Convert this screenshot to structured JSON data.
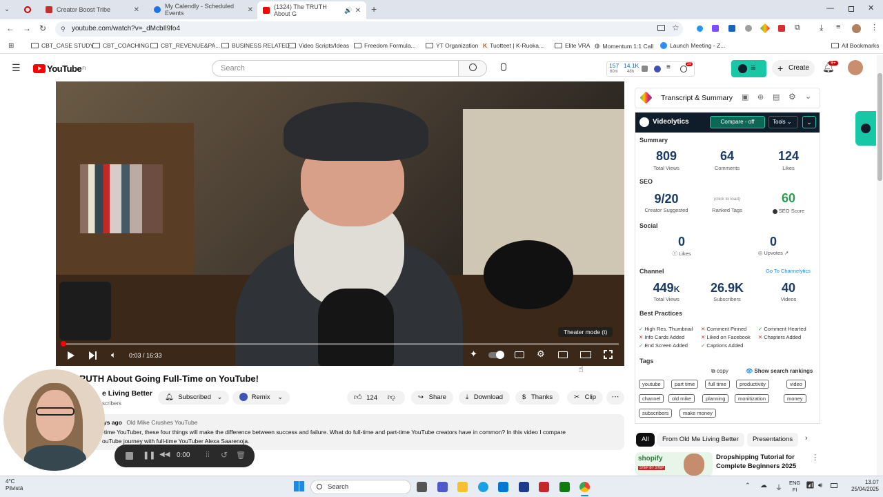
{
  "browser": {
    "tabs": [
      {
        "label": "Creator Boost Tribe"
      },
      {
        "label": "My Calendly - Scheduled Events"
      },
      {
        "label": "(1324) The TRUTH About G"
      }
    ],
    "url": "youtube.com/watch?v=_dMcbIl9fo4",
    "bookmarks": [
      "CBT_CASE STUDY",
      "CBT_COACHING",
      "CBT_REVENUE&PA...",
      "BUSINESS RELATED",
      "Video Scripts/Ideas",
      "Freedom Formula...",
      "YT Organization",
      "Tuotteet | K-Ruoka...",
      "Elite VRA",
      "Momentum 1:1 Call",
      "Launch Meeting - Z...",
      "All Bookmarks"
    ]
  },
  "youtube": {
    "logo": "YouTube",
    "logo_sup": "FI",
    "search_placeholder": "Search",
    "stats_top": "157",
    "stats_sub1": "60m",
    "stats_top2": "14.1K",
    "stats_sub2": "48h",
    "notif_badge": "9+",
    "create_label": "Create",
    "ext_badge": "29"
  },
  "video": {
    "time": "0:03 / 16:33",
    "tooltip": "Theater mode (t)",
    "title": "RUTH About Going Full-Time on YouTube!",
    "channel": "e Living Better",
    "subs": "scribers",
    "subscribed_label": "Subscribed",
    "remix_label": "Remix",
    "likes": "124",
    "share_label": "Share",
    "download_label": "Download",
    "thanks_label": "Thanks",
    "clip_label": "Clip",
    "desc_meta": "ys ago",
    "desc_tag": "Old Mike Crushes YouTube",
    "desc_line1": "-time YouTuber, these four things will make the difference between success and failure. What do full-time and part-time YouTube creators have in common? In this video I compare",
    "desc_line2": "ouTube journey with full-time YouTuber Alexa Saarenoja."
  },
  "recorder": {
    "time": "0:00"
  },
  "panel": {
    "transcript_title": "Transcript & Summary",
    "brand": "Videolytics",
    "compare_label": "Compare - off",
    "tools_label": "Tools",
    "summary_label": "Summary",
    "summary": [
      {
        "value": "809",
        "label": "Total Views"
      },
      {
        "value": "64",
        "label": "Comments"
      },
      {
        "value": "124",
        "label": "Likes"
      }
    ],
    "seo_label": "SEO",
    "seo_suggested": "9/20",
    "seo_suggested_label": "Creator Suggested",
    "seo_click": "(click to load)",
    "seo_ranked_label": "Ranked Tags",
    "seo_score": "60",
    "seo_score_label": "SEO Score",
    "social_label": "Social",
    "social_likes": "0",
    "social_likes_label": "Likes",
    "social_upvotes": "0",
    "social_upvotes_label": "Upvotes",
    "channel_label": "Channel",
    "channel_link": "Go To Channelytics",
    "channel": [
      {
        "value": "449",
        "suffix": "K",
        "label": "Total Views"
      },
      {
        "value": "26.9K",
        "label": "Subscribers"
      },
      {
        "value": "40",
        "label": "Videos"
      }
    ],
    "best_label": "Best Practices",
    "best": [
      {
        "text": "High Res. Thumbnail",
        "ok": true
      },
      {
        "text": "Comment Pinned",
        "ok": false
      },
      {
        "text": "Comment Hearted",
        "ok": true
      },
      {
        "text": "Info Cards Added",
        "ok": false
      },
      {
        "text": "Liked on Facebook",
        "ok": false
      },
      {
        "text": "Chapters Added",
        "ok": false
      },
      {
        "text": "End Screen Added",
        "ok": true
      },
      {
        "text": "Captions Added",
        "ok": true
      }
    ],
    "tags_label": "Tags",
    "copy_label": "copy",
    "show_rankings": "Show search rankings",
    "tags": [
      "youtube",
      "part time",
      "full time",
      "productivity",
      "video",
      "channel",
      "old mike",
      "planning",
      "monitization",
      "money",
      "subscribers",
      "make money"
    ]
  },
  "recommend": {
    "chips": [
      "All",
      "From Old Me Living Better",
      "Presentations"
    ],
    "title": "Dropshipping Tutorial for Complete Beginners 2025",
    "thumb_brand": "shopify",
    "thumb_sub": "STEP BY STEP"
  },
  "taskbar": {
    "weather_temp": "4°C",
    "weather_desc": "Pilvistä",
    "search": "Search",
    "lang1": "ENG",
    "lang2": "FI",
    "time": "13.07",
    "date": "25/04/2025"
  }
}
